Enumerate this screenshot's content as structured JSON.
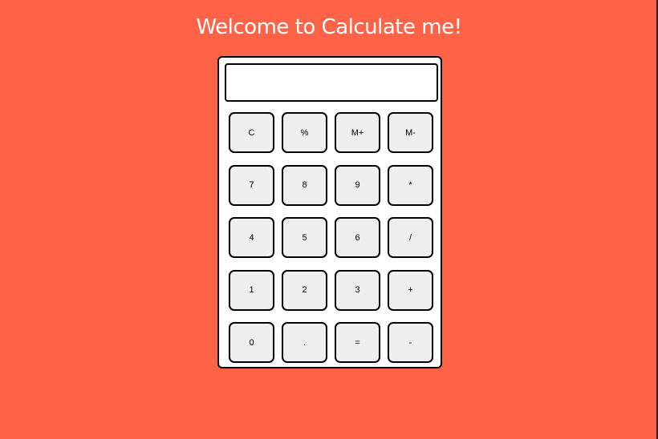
{
  "page": {
    "title": "Welcome to Calculate me!",
    "background_color": "#ff6347"
  },
  "display": {
    "value": ""
  },
  "keys": [
    {
      "label": "C",
      "name": "clear-button"
    },
    {
      "label": "%",
      "name": "percent-button"
    },
    {
      "label": "M+",
      "name": "memory-add-button"
    },
    {
      "label": "M-",
      "name": "memory-subtract-button"
    },
    {
      "label": "7",
      "name": "digit-7-button"
    },
    {
      "label": "8",
      "name": "digit-8-button"
    },
    {
      "label": "9",
      "name": "digit-9-button"
    },
    {
      "label": "*",
      "name": "multiply-button"
    },
    {
      "label": "4",
      "name": "digit-4-button"
    },
    {
      "label": "5",
      "name": "digit-5-button"
    },
    {
      "label": "6",
      "name": "digit-6-button"
    },
    {
      "label": "/",
      "name": "divide-button"
    },
    {
      "label": "1",
      "name": "digit-1-button"
    },
    {
      "label": "2",
      "name": "digit-2-button"
    },
    {
      "label": "3",
      "name": "digit-3-button"
    },
    {
      "label": "+",
      "name": "add-button"
    },
    {
      "label": "0",
      "name": "digit-0-button"
    },
    {
      "label": ".",
      "name": "decimal-point-button"
    },
    {
      "label": "=",
      "name": "equals-button"
    },
    {
      "label": "-",
      "name": "subtract-button"
    }
  ]
}
